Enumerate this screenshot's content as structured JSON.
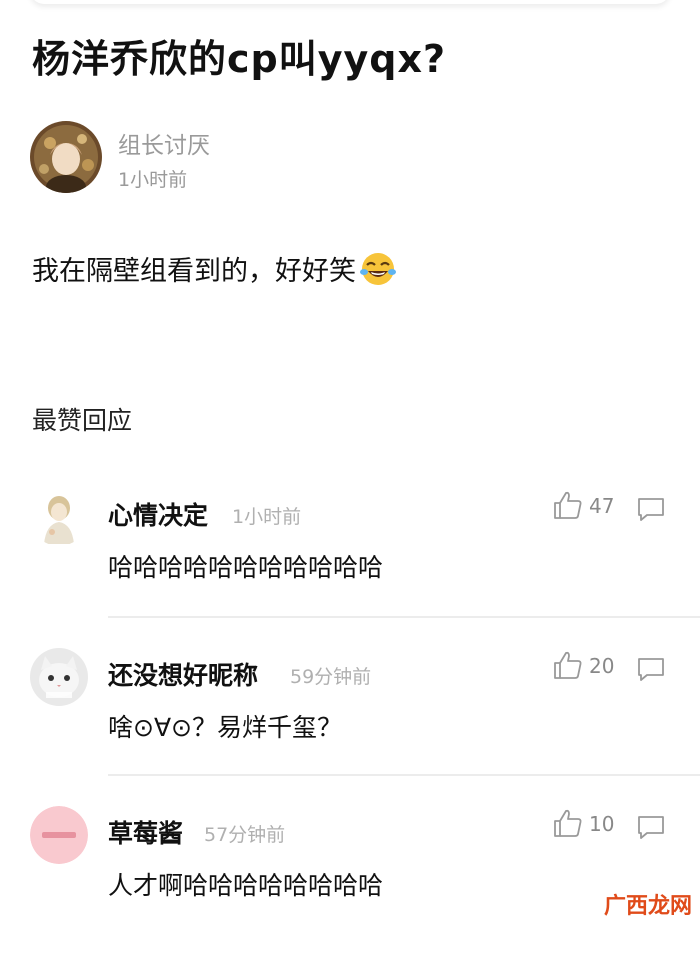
{
  "post": {
    "title": "杨洋乔欣的cp叫yyqx?",
    "author": "组长讨厌",
    "time": "1小时前",
    "body": "我在隔壁组看到的，好好笑"
  },
  "section_title": "最赞回应",
  "comments": [
    {
      "name": "心情决定",
      "time": "1小时前",
      "text": "哈哈哈哈哈哈哈哈哈哈哈",
      "likes": "47"
    },
    {
      "name": "还没想好昵称",
      "time": "59分钟前",
      "text": "啥⊙∀⊙？易烊千玺？",
      "likes": "20"
    },
    {
      "name": "草莓酱",
      "time": "57分钟前",
      "text": "人才啊哈哈哈哈哈哈哈哈",
      "likes": "10"
    }
  ],
  "watermark": {
    "site": "广西龙网"
  },
  "colors": {
    "meta_gray": "#9a9a9a",
    "divider": "#ececec",
    "watermark_red": "#e04b1a"
  }
}
